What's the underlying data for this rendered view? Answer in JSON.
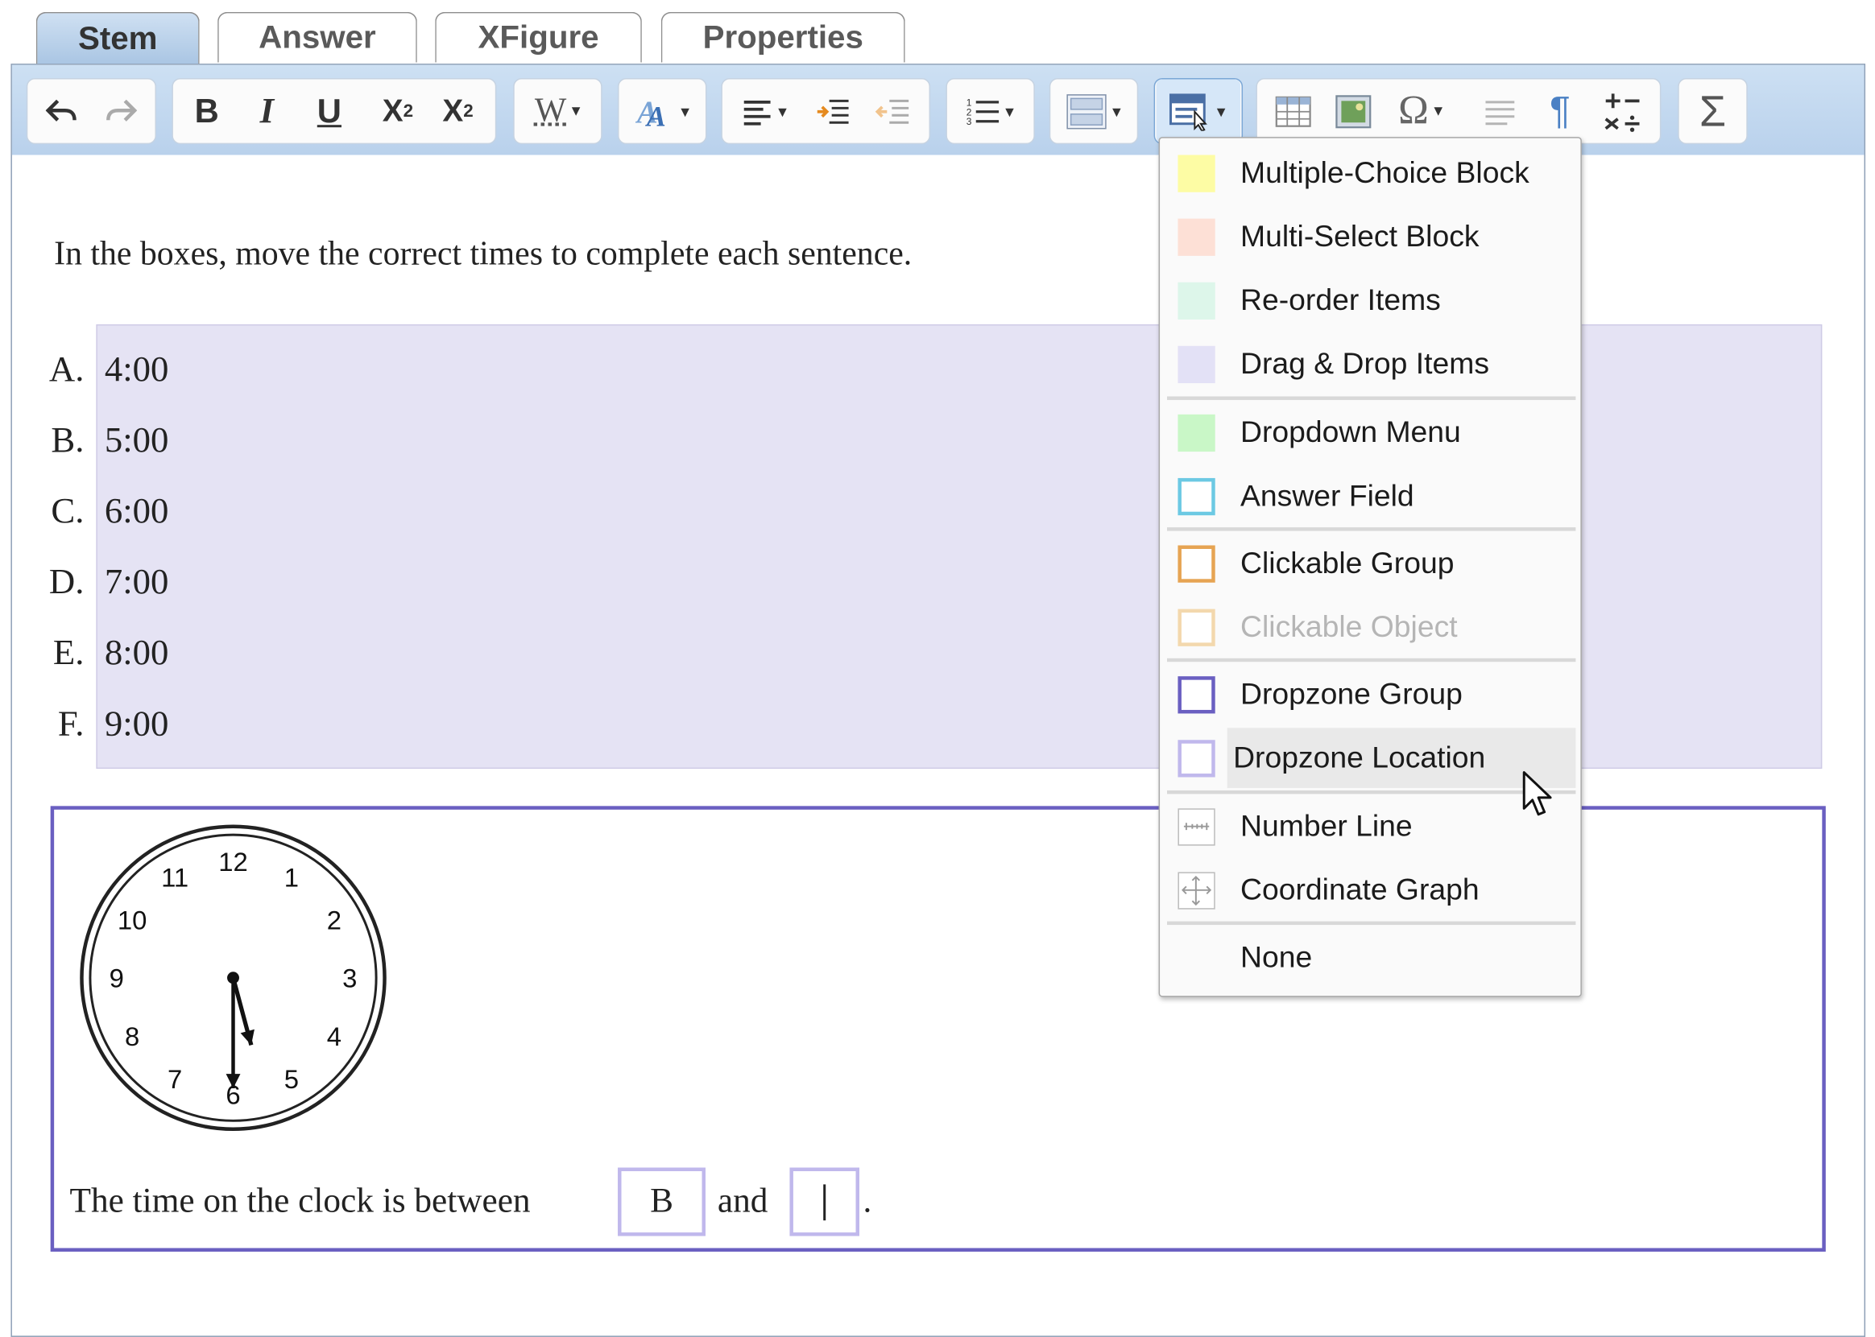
{
  "tabs": [
    {
      "label": "Stem",
      "active": true
    },
    {
      "label": "Answer",
      "active": false
    },
    {
      "label": "XFigure",
      "active": false
    },
    {
      "label": "Properties",
      "active": false
    }
  ],
  "toolbar": {
    "bold": "B",
    "italic": "I",
    "underline": "U",
    "subscript": "X",
    "subscript_mark": "2",
    "superscript": "X",
    "superscript_mark": "2",
    "font_size": "W",
    "special_chars": "Ω",
    "sigma": "Σ",
    "paragraph": "¶"
  },
  "question": "In the boxes, move the correct times to complete each sentence.",
  "options": [
    {
      "letter": "A.",
      "time": "4:00"
    },
    {
      "letter": "B.",
      "time": "5:00"
    },
    {
      "letter": "C.",
      "time": "6:00"
    },
    {
      "letter": "D.",
      "time": "7:00"
    },
    {
      "letter": "E.",
      "time": "8:00"
    },
    {
      "letter": "F.",
      "time": "9:00"
    }
  ],
  "clock": {
    "numbers": [
      "12",
      "1",
      "2",
      "3",
      "4",
      "5",
      "6",
      "7",
      "8",
      "9",
      "10",
      "11"
    ],
    "hour": 5,
    "minute": 30
  },
  "sentence": {
    "prefix": "The time on the clock is between",
    "box1": "B",
    "middle": "and",
    "box2": "",
    "suffix": "."
  },
  "menu": {
    "items": [
      {
        "label": "Multiple-Choice Block",
        "swatch": "#fdfca4",
        "style": "fill"
      },
      {
        "label": "Multi-Select Block",
        "swatch": "#fde0d6",
        "style": "fill"
      },
      {
        "label": "Re-order Items",
        "swatch": "#ddf6ea",
        "style": "fill"
      },
      {
        "label": "Drag & Drop Items",
        "swatch": "#e3e1f6",
        "style": "fill"
      },
      {
        "label": "Dropdown Menu",
        "swatch": "#c9f7c7",
        "style": "fill"
      },
      {
        "label": "Answer Field",
        "swatch": "#6cc9e3",
        "style": "outline"
      },
      {
        "label": "Clickable Group",
        "swatch": "#e6a453",
        "style": "outline"
      },
      {
        "label": "Clickable Object",
        "swatch": "#f3d8ad",
        "style": "outline",
        "disabled": true
      },
      {
        "label": "Dropzone Group",
        "swatch": "#6a5fc1",
        "style": "outline"
      },
      {
        "label": "Dropzone Location",
        "swatch": "#c0b8ec",
        "style": "outline",
        "hover": true
      },
      {
        "label": "Number Line",
        "swatch": "#bbbbbb",
        "style": "numberline"
      },
      {
        "label": "Coordinate Graph",
        "swatch": "#bbbbbb",
        "style": "graph"
      },
      {
        "label": "None",
        "swatch": "",
        "style": "none"
      }
    ]
  }
}
